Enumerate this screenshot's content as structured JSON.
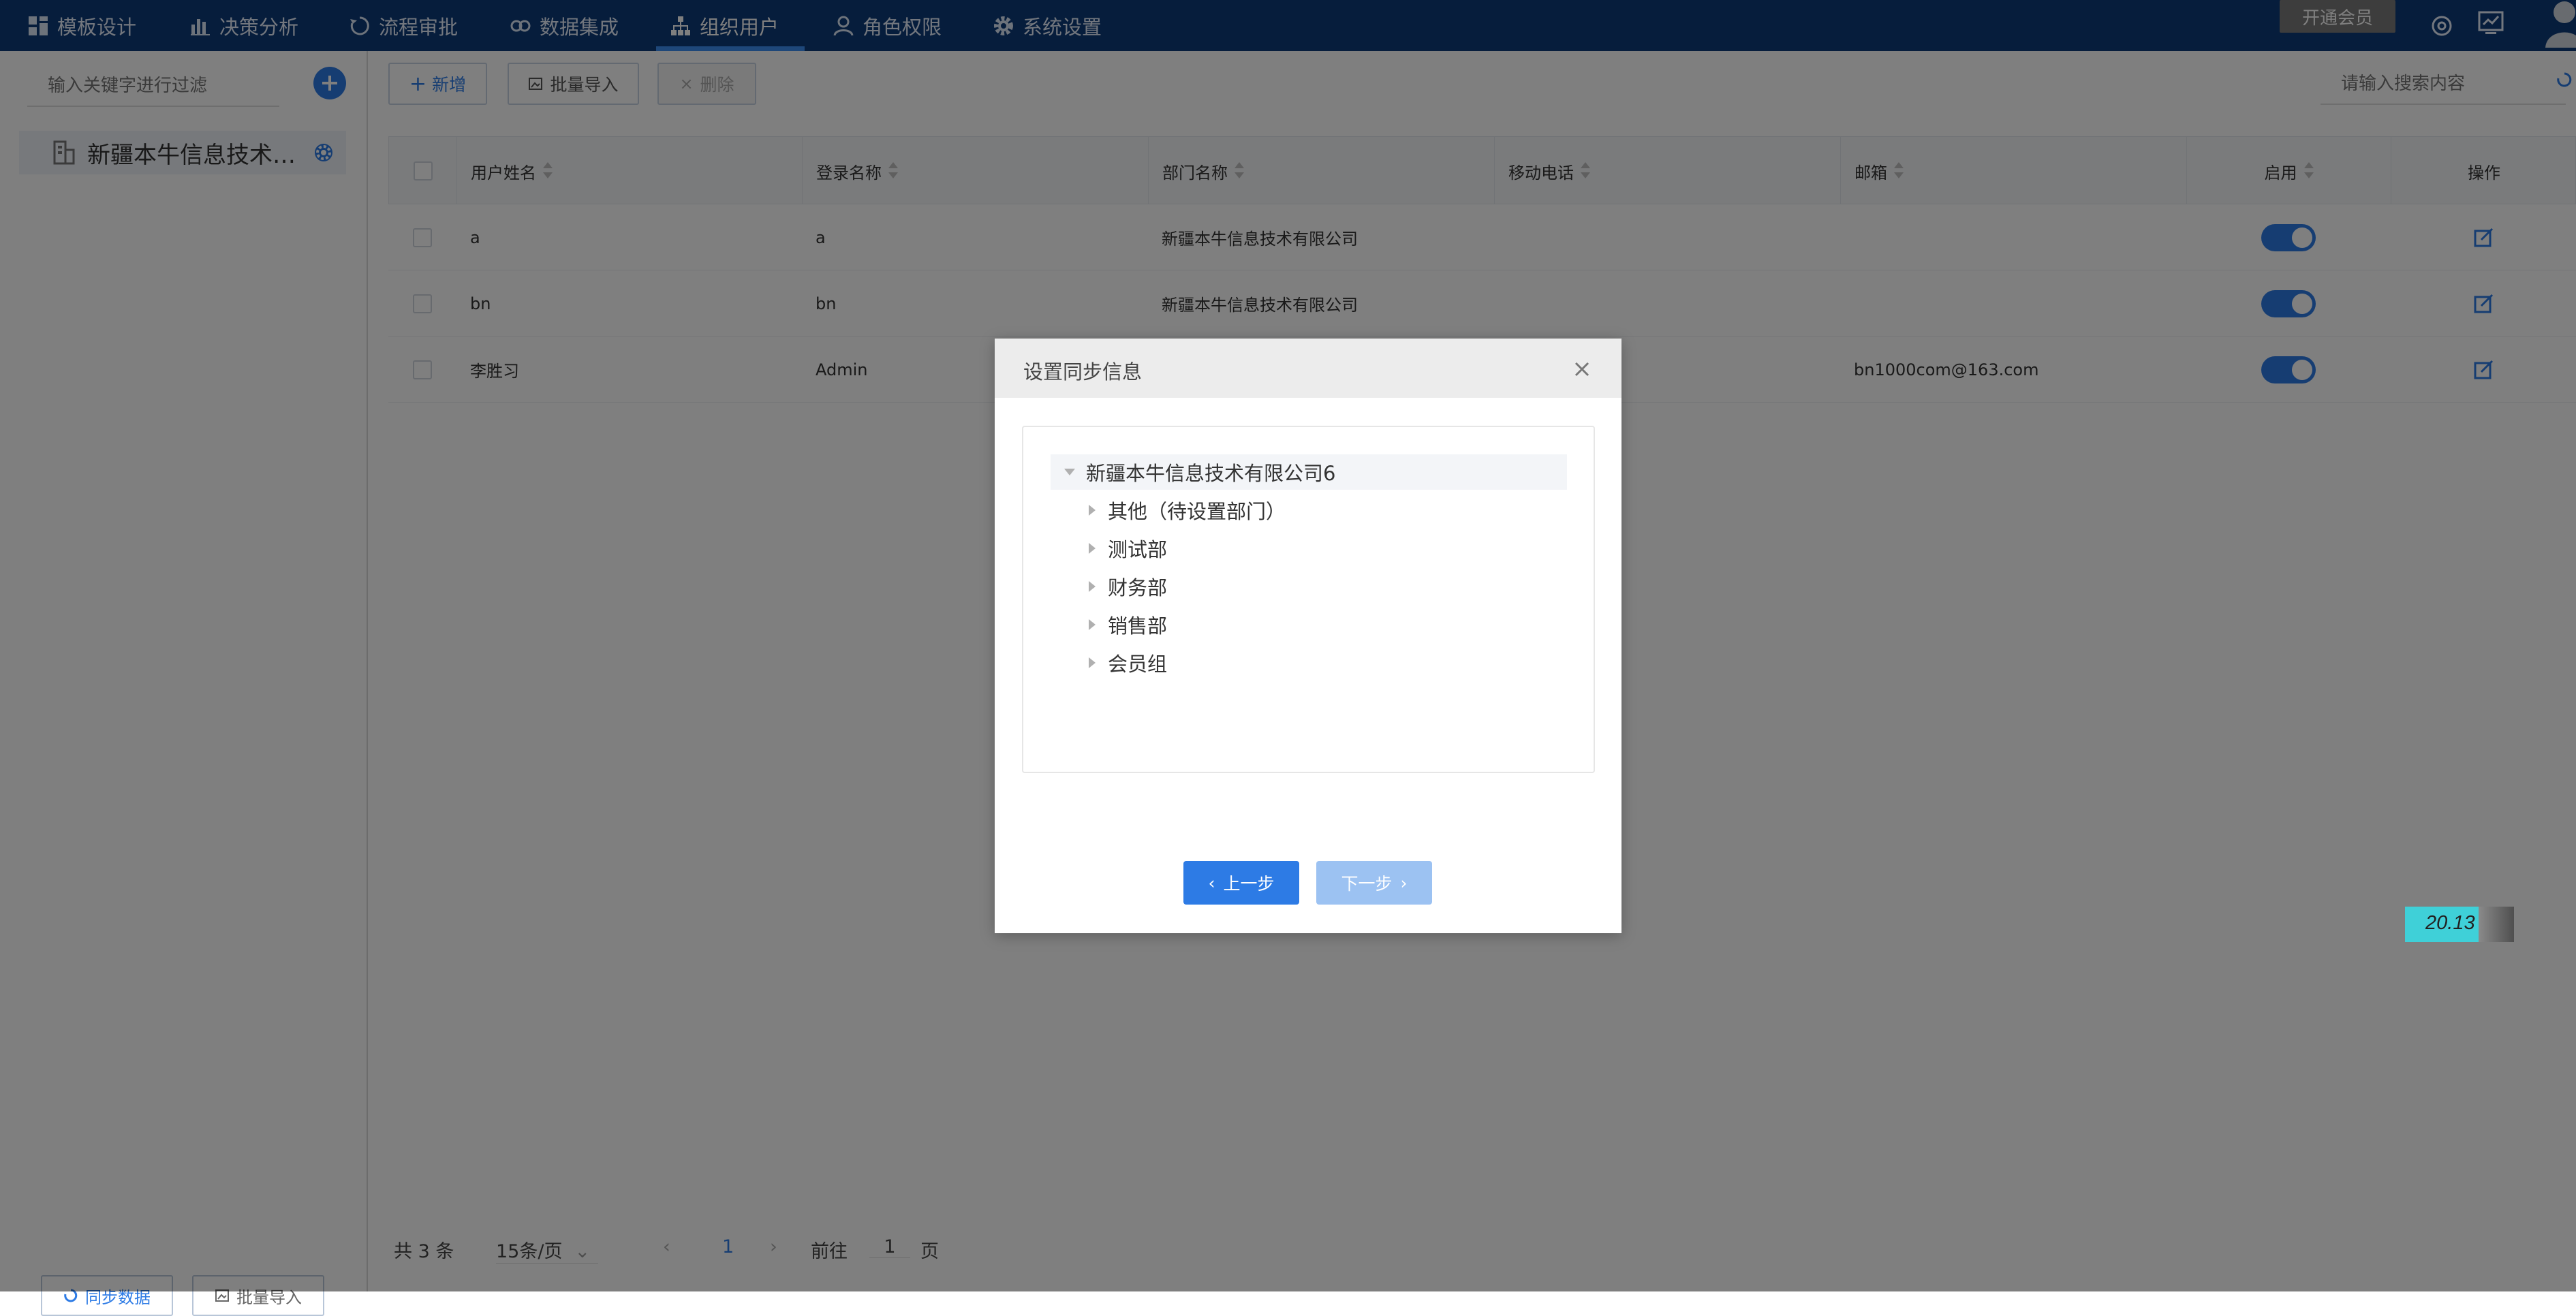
{
  "topnav": {
    "items": [
      {
        "label": "模板设计",
        "icon": "grid-icon"
      },
      {
        "label": "决策分析",
        "icon": "bar-chart-icon"
      },
      {
        "label": "流程审批",
        "icon": "refresh-icon"
      },
      {
        "label": "数据集成",
        "icon": "link-icon"
      },
      {
        "label": "组织用户",
        "icon": "org-chart-icon"
      },
      {
        "label": "角色权限",
        "icon": "user-icon"
      },
      {
        "label": "系统设置",
        "icon": "gear-icon"
      }
    ],
    "active_index": 4,
    "vip_label": "开通会员"
  },
  "sidebar": {
    "filter_placeholder": "输入关键字进行过滤",
    "org_label": "新疆本牛信息技术有...",
    "sync_label": "同步数据",
    "import_label": "批量导入"
  },
  "toolbar": {
    "add_label": "新增",
    "import_label": "批量导入",
    "delete_label": "删除",
    "search_placeholder": "请输入搜索内容"
  },
  "table": {
    "columns": [
      "用户姓名",
      "登录名称",
      "部门名称",
      "移动电话",
      "邮箱",
      "启用",
      "操作"
    ],
    "rows": [
      {
        "name": "a",
        "login": "a",
        "dept": "新疆本牛信息技术有限公司",
        "phone": "",
        "email": ""
      },
      {
        "name": "bn",
        "login": "bn",
        "dept": "新疆本牛信息技术有限公司",
        "phone": "",
        "email": ""
      },
      {
        "name": "李胜习",
        "login": "Admin",
        "dept": "",
        "phone": "",
        "email": "bn1000com@163.com"
      }
    ]
  },
  "pager": {
    "total": "共 3 条",
    "page_size": "15条/页",
    "current": "1",
    "goto_prefix": "前往",
    "goto_value": "1",
    "goto_suffix": "页"
  },
  "badge": {
    "value": "20.13"
  },
  "dialog": {
    "title": "设置同步信息",
    "tree_root": "新疆本牛信息技术有限公司6",
    "tree_children": [
      "其他（待设置部门）",
      "测试部",
      "财务部",
      "销售部",
      "会员组"
    ],
    "prev_label": "上一步",
    "next_label": "下一步"
  },
  "colors": {
    "nav_bg": "#0d3a78",
    "accent": "#2d7be5",
    "button_disabled": "#9cc2f2"
  }
}
